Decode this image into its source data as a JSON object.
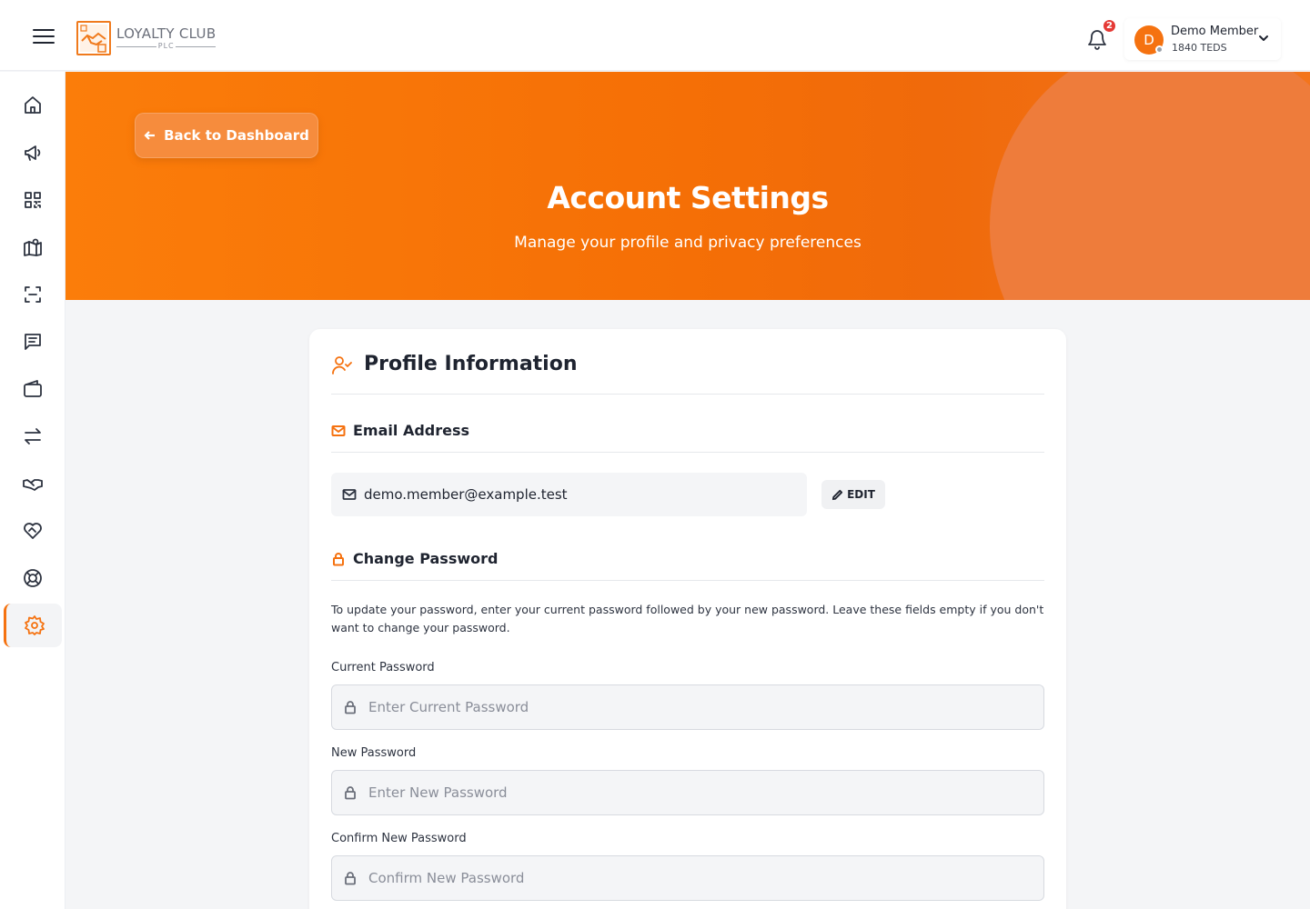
{
  "header": {
    "logo_name": "LOYALTY CLUB",
    "logo_sub": "PLC",
    "notification_count": "2",
    "user_name": "Demo Member",
    "user_points": "1840 TEDS",
    "avatar_initial": "D"
  },
  "sidebar": {
    "items": [
      {
        "icon": "home-icon"
      },
      {
        "icon": "megaphone-icon"
      },
      {
        "icon": "qr-code-icon"
      },
      {
        "icon": "map-icon"
      },
      {
        "icon": "scan-icon"
      },
      {
        "icon": "message-icon"
      },
      {
        "icon": "wallet-icon"
      },
      {
        "icon": "transfer-icon"
      },
      {
        "icon": "handshake-icon"
      },
      {
        "icon": "heart-handshake-icon"
      },
      {
        "icon": "lifebuoy-icon"
      },
      {
        "icon": "settings-icon",
        "active": true
      }
    ]
  },
  "hero": {
    "back_label": "Back to Dashboard",
    "title": "Account Settings",
    "subtitle": "Manage your profile and privacy preferences"
  },
  "profile": {
    "title": "Profile Information",
    "email_section_title": "Email Address",
    "email_value": "demo.member@example.test",
    "edit_label": "EDIT",
    "password_section_title": "Change Password",
    "password_help": "To update your password, enter your current password followed by your new password. Leave these fields empty if you don't want to change your password.",
    "current_password_label": "Current Password",
    "current_password_placeholder": "Enter Current Password",
    "new_password_label": "New Password",
    "new_password_placeholder": "Enter New Password",
    "confirm_password_label": "Confirm New Password",
    "confirm_password_placeholder": "Confirm New Password"
  },
  "colors": {
    "accent": "#f57210",
    "notification": "#e53935"
  }
}
